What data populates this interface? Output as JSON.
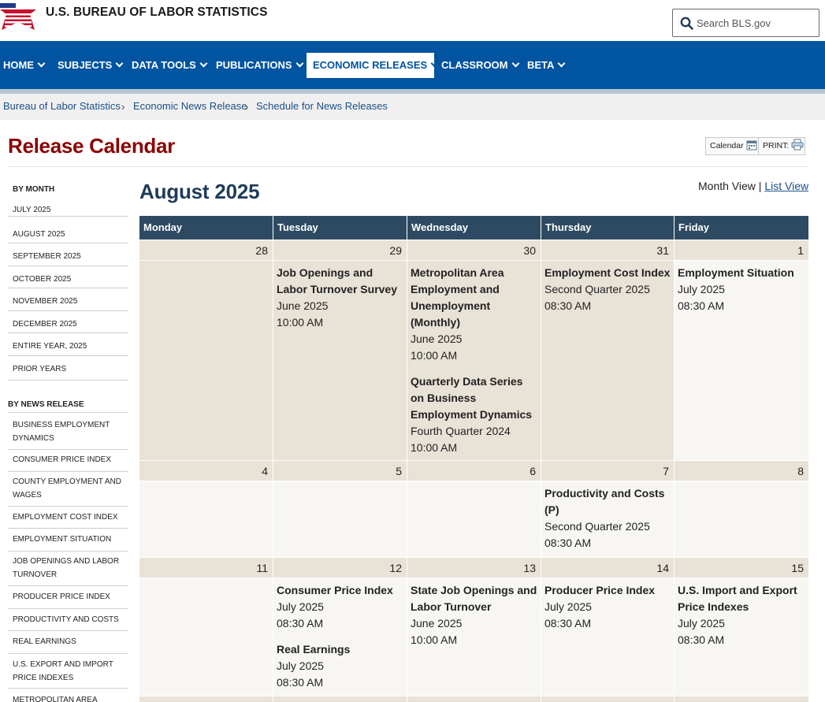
{
  "header": {
    "site_title": "U.S. BUREAU OF LABOR STATISTICS",
    "search_placeholder": "Search BLS.gov"
  },
  "nav": {
    "items": [
      {
        "label": "HOME"
      },
      {
        "label": "SUBJECTS"
      },
      {
        "label": "DATA TOOLS"
      },
      {
        "label": "PUBLICATIONS"
      },
      {
        "label": "ECONOMIC RELEASES"
      },
      {
        "label": "CLASSROOM"
      },
      {
        "label": "BETA"
      }
    ],
    "active": "ECONOMIC RELEASES"
  },
  "breadcrumb": [
    "Bureau of Labor Statistics",
    "Economic News Release",
    "Schedule for News Releases"
  ],
  "page": {
    "title": "Release Calendar",
    "tools": {
      "calendar_label": "Calendar",
      "print_label": "PRINT:"
    }
  },
  "sidebar": {
    "by_month_heading": "BY MONTH",
    "months": [
      "JULY 2025",
      "AUGUST 2025",
      "SEPTEMBER 2025",
      "OCTOBER 2025",
      "NOVEMBER 2025",
      "DECEMBER 2025",
      "ENTIRE YEAR, 2025",
      "PRIOR YEARS"
    ],
    "by_release_heading": "BY NEWS RELEASE",
    "releases": [
      "BUSINESS EMPLOYMENT DYNAMICS",
      "CONSUMER PRICE INDEX",
      "COUNTY EMPLOYMENT AND WAGES",
      "EMPLOYMENT COST INDEX",
      "EMPLOYMENT SITUATION",
      "JOB OPENINGS AND LABOR TURNOVER",
      "PRODUCER PRICE INDEX",
      "PRODUCTIVITY AND COSTS",
      "REAL EARNINGS",
      "U.S. EXPORT AND IMPORT PRICE INDEXES",
      "METROPOLITAN AREA"
    ]
  },
  "calendar": {
    "title": "August 2025",
    "view": {
      "current": "Month View",
      "separator": "|",
      "other": "List View"
    },
    "weekdays": [
      "Monday",
      "Tuesday",
      "Wednesday",
      "Thursday",
      "Friday"
    ],
    "weeks": [
      {
        "days": [
          {
            "num": "28",
            "events": [],
            "shaded": true
          },
          {
            "num": "29",
            "shaded": true,
            "events": [
              {
                "name": "Job Openings and Labor Turnover Survey",
                "period": "June 2025",
                "time": "10:00 AM"
              }
            ]
          },
          {
            "num": "30",
            "shaded": true,
            "events": [
              {
                "name": "Metropolitan Area Employment and Unemployment (Monthly)",
                "period": "June 2025",
                "time": "10:00 AM"
              },
              {
                "name": "Quarterly Data Series on Business Employment Dynamics",
                "period": "Fourth Quarter 2024",
                "time": "10:00 AM"
              }
            ]
          },
          {
            "num": "31",
            "shaded": true,
            "events": [
              {
                "name": "Employment Cost Index",
                "period": "Second Quarter 2025",
                "time": "08:30 AM"
              }
            ]
          },
          {
            "num": "1",
            "shaded": false,
            "events": [
              {
                "name": "Employment Situation",
                "period": "July 2025",
                "time": "08:30 AM"
              }
            ]
          }
        ]
      },
      {
        "days": [
          {
            "num": "4",
            "shaded": false,
            "events": []
          },
          {
            "num": "5",
            "shaded": false,
            "events": []
          },
          {
            "num": "6",
            "shaded": false,
            "events": []
          },
          {
            "num": "7",
            "shaded": false,
            "events": [
              {
                "name": "Productivity and Costs (P)",
                "period": "Second Quarter 2025",
                "time": "08:30 AM"
              }
            ]
          },
          {
            "num": "8",
            "shaded": false,
            "events": []
          }
        ]
      },
      {
        "days": [
          {
            "num": "11",
            "shaded": false,
            "events": []
          },
          {
            "num": "12",
            "shaded": false,
            "events": [
              {
                "name": "Consumer Price Index",
                "period": "July 2025",
                "time": "08:30 AM"
              },
              {
                "name": "Real Earnings",
                "period": "July 2025",
                "time": "08:30 AM"
              }
            ]
          },
          {
            "num": "13",
            "shaded": false,
            "events": [
              {
                "name": "State Job Openings and Labor Turnover",
                "period": "June 2025",
                "time": "10:00 AM"
              }
            ]
          },
          {
            "num": "14",
            "shaded": false,
            "events": [
              {
                "name": "Producer Price Index",
                "period": "July 2025",
                "time": "08:30 AM"
              }
            ]
          },
          {
            "num": "15",
            "shaded": false,
            "events": [
              {
                "name": "U.S. Import and Export Price Indexes",
                "period": "July 2025",
                "time": "08:30 AM"
              }
            ]
          }
        ]
      }
    ]
  },
  "colors": {
    "nav_blue": "#0054a0",
    "title_red": "#8b0000",
    "cal_header": "#2e4a62",
    "cell_shaded": "#e8e2d7",
    "cell_light": "#f7f6f3"
  }
}
